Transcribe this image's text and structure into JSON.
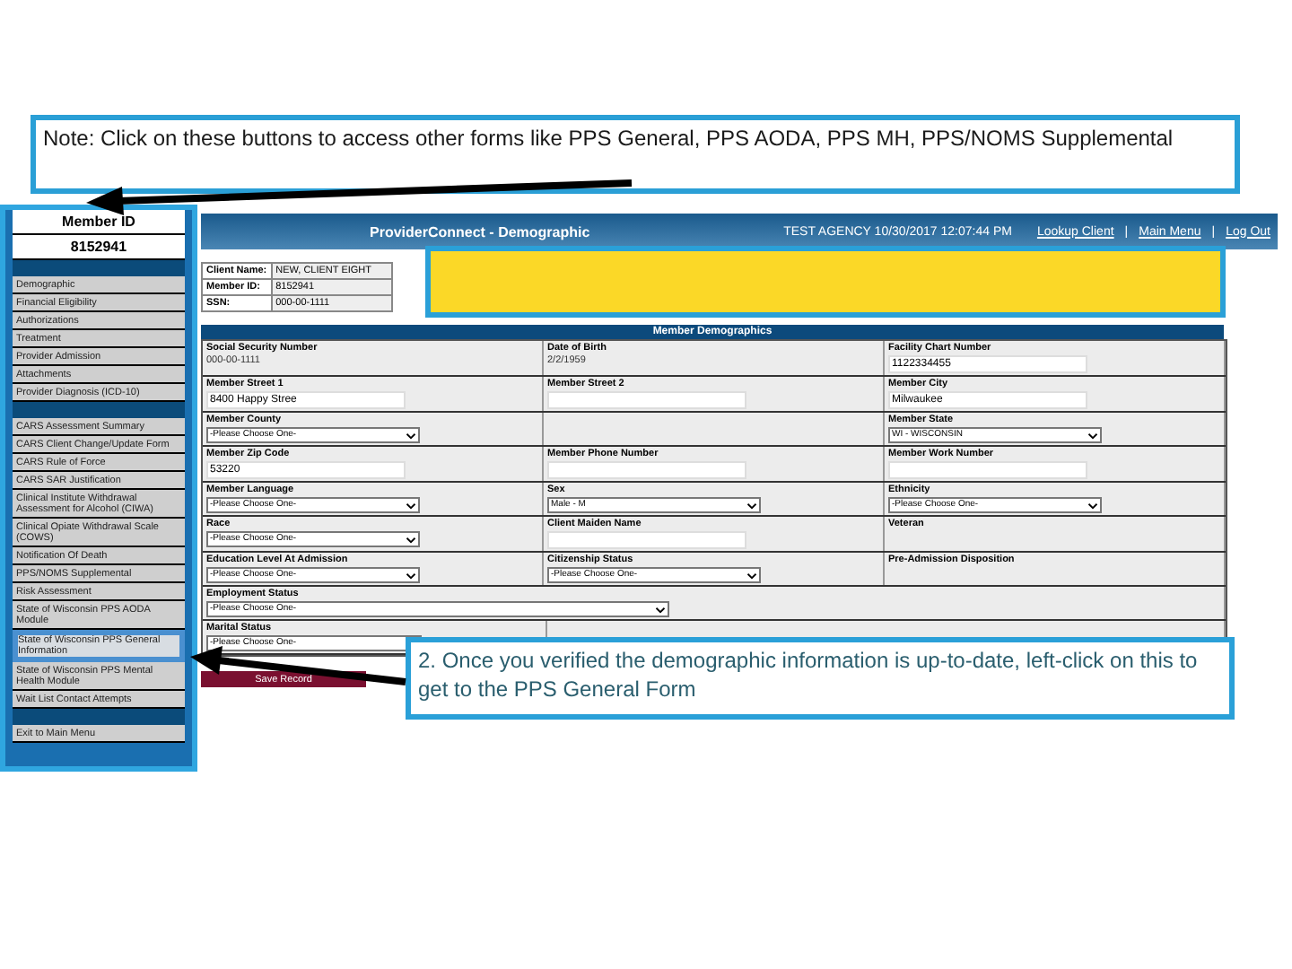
{
  "note": "Note: Click on these buttons to access other forms like PPS General, PPS AODA, PPS MH, PPS/NOMS Supplemental",
  "sidebar": {
    "member_id_label": "Member ID",
    "member_id": "8152941",
    "groups": [
      [
        {
          "label": "Demographic",
          "highlighted": false
        },
        {
          "label": "Financial Eligibility",
          "highlighted": false
        },
        {
          "label": "Authorizations",
          "highlighted": false
        },
        {
          "label": "Treatment",
          "highlighted": false
        },
        {
          "label": "Provider Admission",
          "highlighted": false
        },
        {
          "label": "Attachments",
          "highlighted": false
        },
        {
          "label": "Provider Diagnosis (ICD-10)",
          "highlighted": false
        }
      ],
      [
        {
          "label": "CARS Assessment Summary",
          "highlighted": false
        },
        {
          "label": "CARS Client Change/Update Form",
          "highlighted": false
        },
        {
          "label": "CARS Rule of Force",
          "highlighted": false
        },
        {
          "label": "CARS SAR Justification",
          "highlighted": false
        },
        {
          "label": "Clinical Institute Withdrawal Assessment for Alcohol (CIWA)",
          "highlighted": false
        },
        {
          "label": "Clinical Opiate Withdrawal Scale (COWS)",
          "highlighted": false
        },
        {
          "label": "Notification Of Death",
          "highlighted": false
        },
        {
          "label": "PPS/NOMS Supplemental",
          "highlighted": false
        },
        {
          "label": "Risk Assessment",
          "highlighted": false
        },
        {
          "label": "State of Wisconsin PPS AODA Module",
          "highlighted": false
        },
        {
          "label": "State of Wisconsin PPS General Information",
          "highlighted": true
        },
        {
          "label": "State of Wisconsin PPS Mental Health Module",
          "highlighted": false
        },
        {
          "label": "Wait List Contact Attempts",
          "highlighted": false
        }
      ],
      [
        {
          "label": "Exit to Main Menu",
          "highlighted": false
        }
      ]
    ]
  },
  "header": {
    "title": "ProviderConnect - Demographic",
    "agency": "TEST AGENCY  10/30/2017 12:07:44 PM",
    "links": [
      "Lookup Client",
      "Main Menu",
      "Log Out"
    ],
    "separator": "|"
  },
  "client_info": [
    {
      "label": "Client Name:",
      "value": "NEW, CLIENT EIGHT"
    },
    {
      "label": "Member ID:",
      "value": "8152941"
    },
    {
      "label": "SSN:",
      "value": "000-00-1111"
    }
  ],
  "section_title": "Member Demographics",
  "rows": [
    [
      {
        "label": "Social Security Number",
        "kind": "text",
        "value": "000-00-1111"
      },
      {
        "label": "Date of Birth",
        "kind": "text",
        "value": "2/2/1959"
      },
      {
        "label": "Facility Chart Number",
        "kind": "input",
        "value": "1122334455"
      }
    ],
    [
      {
        "label": "Member Street 1",
        "kind": "input",
        "value": "8400 Happy Stree"
      },
      {
        "label": "Member Street 2",
        "kind": "input"
      },
      {
        "label": "Member City",
        "kind": "input",
        "value": "Milwaukee"
      }
    ],
    [
      {
        "label": "Member County",
        "kind": "select",
        "value": "-Please Choose One-"
      },
      {
        "kind": "empty"
      },
      {
        "label": "Member State",
        "kind": "select",
        "value": "WI - WISCONSIN"
      }
    ],
    [
      {
        "label": "Member Zip Code",
        "kind": "input",
        "value": "53220"
      },
      {
        "label": "Member Phone Number",
        "kind": "input"
      },
      {
        "label": "Member Work Number",
        "kind": "input"
      }
    ],
    [
      {
        "label": "Member Language",
        "kind": "select",
        "value": "-Please Choose One-"
      },
      {
        "label": "Sex",
        "kind": "select",
        "value": "Male - M"
      },
      {
        "label": "Ethnicity",
        "kind": "select",
        "value": "-Please Choose One-"
      }
    ],
    [
      {
        "label": "Race",
        "kind": "select",
        "value": "-Please Choose One-"
      },
      {
        "label": "Client Maiden Name",
        "kind": "input"
      },
      {
        "label": "Veteran",
        "kind": "label"
      }
    ],
    [
      {
        "label": "Education Level At Admission",
        "kind": "select",
        "value": "-Please Choose One-"
      },
      {
        "label": "Citizenship Status",
        "kind": "select",
        "value": "-Please Choose One-"
      },
      {
        "label": "Pre-Admission Disposition",
        "kind": "label"
      }
    ],
    [
      {
        "label": "Employment Status",
        "kind": "select",
        "value": "-Please Choose One-",
        "wide": true
      }
    ],
    [
      {
        "label": "Marital Status",
        "kind": "select",
        "value": "-Please Choose One-"
      },
      {
        "kind": "empty",
        "wide": true
      }
    ]
  ],
  "save_button": "Save Record",
  "callout": "2. Once you verified the demographic information is up-to-date, left-click on this to get to the PPS General Form"
}
